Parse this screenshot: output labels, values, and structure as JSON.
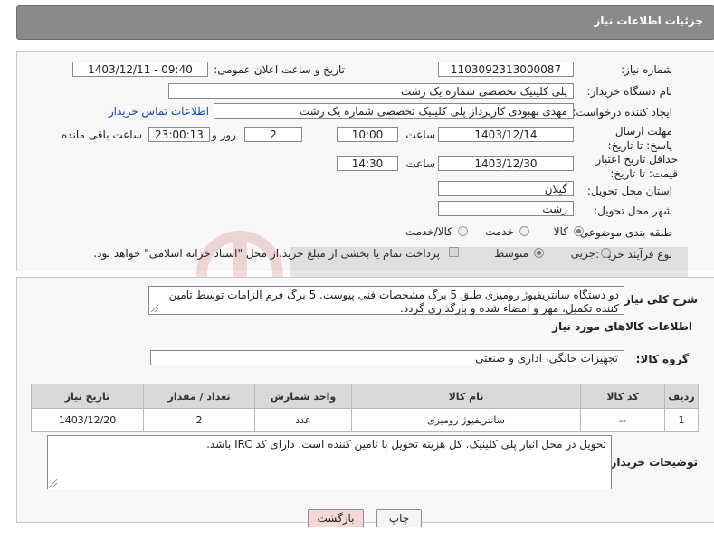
{
  "header": {
    "title": "جزئیات اطلاعات نیاز"
  },
  "info": {
    "need_number_label": "شماره نیاز:",
    "need_number": "1103092313000087",
    "announce_label": "تاریخ و ساعت اعلان عمومی:",
    "announce_value": "1403/12/11 - 09:40",
    "buyer_label": "نام دستگاه خریدار:",
    "buyer_value": "پلی کلینیک تخصصی شماره یک رشت",
    "creator_label": "ایجاد کننده درخواست:",
    "creator_value": "مهدی بهبودی کارپرداز پلی کلینیک تخصصی شماره یک رشت",
    "contact_link": "اطلاعات تماس خریدار",
    "deadline_label": "مهلت ارسال پاسخ: تا تاریخ:",
    "deadline_date": "1403/12/14",
    "time_label": "ساعت",
    "deadline_time": "10:00",
    "days_value": "2",
    "days_label": "روز و",
    "remaining_value": "23:00:13",
    "remaining_label": "ساعت باقی مانده",
    "validity_label": "حداقل تاریخ اعتبار قیمت: تا تاریخ:",
    "validity_date": "1403/12/30",
    "validity_time": "14:30",
    "province_label": "استان محل تحویل:",
    "province_value": "گیلان",
    "city_label": "شهر محل تحویل:",
    "city_value": "رشت",
    "category_label": "طبقه بندی موضوعی:",
    "category_options": [
      "کالا",
      "خدمت",
      "کالا/خدمت"
    ],
    "process_label": "نوع فرآیند خرید :",
    "process_options": [
      "جزیی",
      "متوسط"
    ],
    "payment_note": "پرداخت تمام یا بخشی از مبلغ خرید،از محل \"اسناد خزانه اسلامی\" خواهد بود."
  },
  "desc": {
    "label": "شرح کلی نیاز:",
    "text": "دو دستگاه سانتریفیوژ رومیزی طبق 5 برگ مشخصات فنی پیوست. 5 برگ فرم الزامات توسط تامین کننده تکمیل، مهر و امضاء شده و بارگذاری گردد."
  },
  "goods": {
    "section_title": "اطلاعات کالاهای مورد نیاز",
    "group_label": "گروه کالا:",
    "group_value": "تجهیزات خانگی، اداری و صنعتی",
    "columns": [
      "ردیف",
      "کد کالا",
      "نام کالا",
      "واحد شمارش",
      "تعداد / مقدار",
      "تاریخ نیاز"
    ],
    "rows": [
      [
        "1",
        "--",
        "سانتریفیوژ رومیزی",
        "عدد",
        "2",
        "1403/12/20"
      ]
    ]
  },
  "buyer_notes": {
    "label": "توضیحات خریدار:",
    "text": "تحویل در محل انبار پلی کلینیک. کل هزینه تحویل با تامین کننده است. دارای کد IRC باشد."
  },
  "buttons": {
    "print": "چاپ",
    "back": "بازگشت"
  },
  "colors": {
    "header": "#8a8a8a",
    "link": "#1a3fb5",
    "back_button": "#f6d7d7"
  }
}
